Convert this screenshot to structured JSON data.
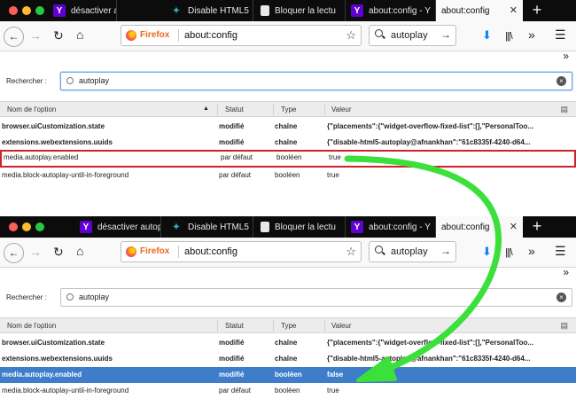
{
  "top": {
    "tabs": [
      {
        "label": "désactiver autop",
        "icon": "yahoo-icon"
      },
      {
        "label": "Disable HTML5",
        "icon": "addon-icon"
      },
      {
        "label": "Bloquer la lectu",
        "icon": "page-icon"
      },
      {
        "label": "about:config - Y",
        "icon": "yahoo-icon"
      },
      {
        "label": "about:config",
        "icon": "",
        "active": true
      }
    ],
    "browser_name": "Firefox",
    "url": "about:config",
    "search_value": "autoplay",
    "filter_label": "Rechercher :",
    "filter_value": "autoplay",
    "columns": [
      "Nom de l'option",
      "Statut",
      "Type",
      "Valeur"
    ],
    "rows": [
      {
        "name": "browser.uiCustomization.state",
        "status": "modifié",
        "type": "chaîne",
        "value": "{\"placements\":{\"widget-overflow-fixed-list\":[],\"PersonalToo..."
      },
      {
        "name": "extensions.webextensions.uuids",
        "status": "modifié",
        "type": "chaîne",
        "value": "{\"disable-html5-autoplay@afnankhan\":\"61c8335f-4240-d64..."
      },
      {
        "name": "media.autoplay.enabled",
        "status": "par défaut",
        "type": "booléen",
        "value": "true"
      },
      {
        "name": "media.block-autoplay-until-in-foreground",
        "status": "par défaut",
        "type": "booléen",
        "value": "true"
      }
    ]
  },
  "bottom": {
    "tabs": [
      {
        "label": "désactiver autop",
        "icon": "yahoo-icon"
      },
      {
        "label": "Disable HTML5",
        "icon": "addon-icon"
      },
      {
        "label": "Bloquer la lectu",
        "icon": "page-icon"
      },
      {
        "label": "about:config - Y",
        "icon": "yahoo-icon"
      },
      {
        "label": "about:config",
        "icon": "",
        "active": true
      }
    ],
    "browser_name": "Firefox",
    "url": "about:config",
    "search_value": "autoplay",
    "filter_label": "Rechercher :",
    "filter_value": "autoplay",
    "columns": [
      "Nom de l'option",
      "Statut",
      "Type",
      "Valeur"
    ],
    "rows": [
      {
        "name": "browser.uiCustomization.state",
        "status": "modifié",
        "type": "chaîne",
        "value": "{\"placements\":{\"widget-overflow-fixed-list\":[],\"PersonalToo..."
      },
      {
        "name": "extensions.webextensions.uuids",
        "status": "modifié",
        "type": "chaîne",
        "value": "{\"disable-html5-autoplay@afnankhan\":\"61c8335f-4240-d64..."
      },
      {
        "name": "media.autoplay.enabled",
        "status": "modifié",
        "type": "booléen",
        "value": "false"
      },
      {
        "name": "media.block-autoplay-until-in-foreground",
        "status": "par défaut",
        "type": "booléen",
        "value": "true"
      }
    ]
  },
  "colors": {
    "tab_strip": "#0c0c0d",
    "highlight_box": "#d0222b",
    "selected_row": "#3d7dca",
    "annotation_arrow": "#3be03b",
    "firefox_label": "#e86b1f"
  }
}
